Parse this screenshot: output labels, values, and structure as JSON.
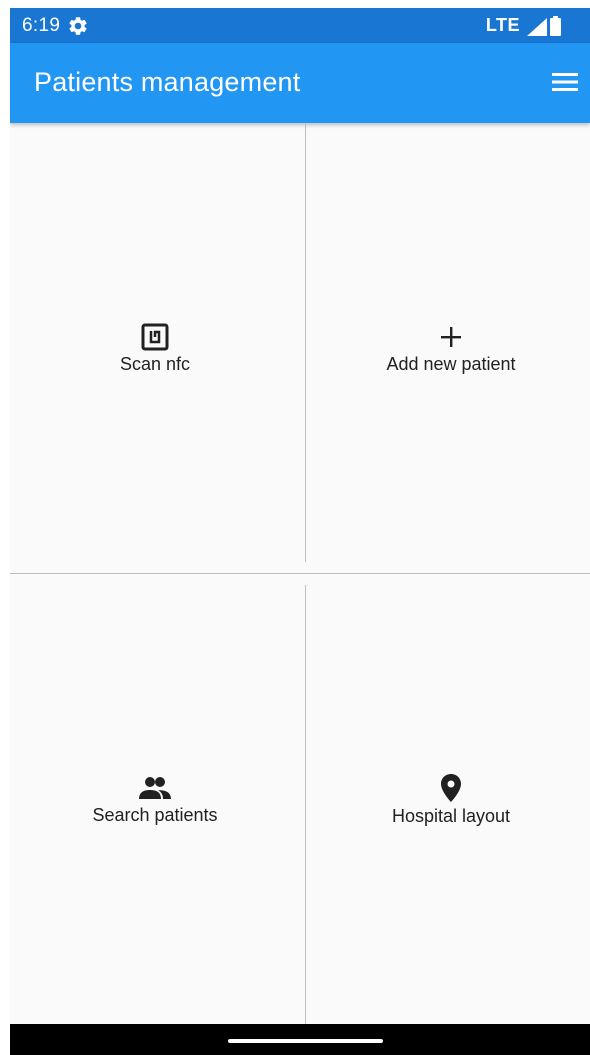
{
  "status_bar": {
    "time": "6:19",
    "network": "LTE",
    "icons": [
      "settings-icon",
      "signal-icon",
      "battery-icon"
    ]
  },
  "app_bar": {
    "title": "Patients management",
    "menu_icon": "menu-icon"
  },
  "tiles": [
    {
      "label": "Scan nfc",
      "icon": "nfc-icon"
    },
    {
      "label": "Add new patient",
      "icon": "plus-icon"
    },
    {
      "label": "Search patients",
      "icon": "people-icon"
    },
    {
      "label": "Hospital layout",
      "icon": "location-pin-icon"
    }
  ],
  "colors": {
    "status_bar": "#1976d2",
    "app_bar": "#2196f3",
    "background": "#fafafa",
    "divider": "#bdbdbd",
    "text": "#212121"
  }
}
